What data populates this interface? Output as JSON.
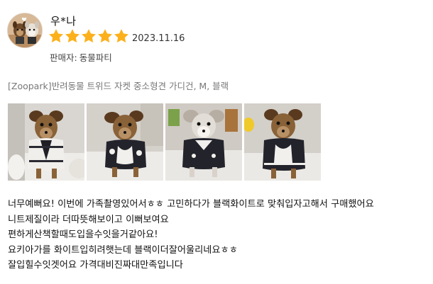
{
  "reviewer": {
    "name": "우*나",
    "avatar_icon": "dog-profile-photo"
  },
  "rating": {
    "value": 5,
    "max": 5,
    "color": "#fcb01b"
  },
  "date": "2023.11.16",
  "seller": {
    "label": "판매자:",
    "name": "동물파티"
  },
  "product": {
    "name": "[Zoopark]반려동물 트위드 자켓 중소형견 가디건, M, 블랙"
  },
  "photos": [
    {
      "name": "review-photo-1",
      "subject": "dog in tweed cardigan, front view"
    },
    {
      "name": "review-photo-2",
      "subject": "dog in tweed cardigan, side view"
    },
    {
      "name": "review-photo-3",
      "subject": "dog in tweed cardigan, sitting"
    },
    {
      "name": "review-photo-4",
      "subject": "dog in tweed cardigan, close up"
    }
  ],
  "review_text": [
    "너무예뻐요! 이번에 가족촬영있어서ㅎㅎ 고민하다가 블랙화이트로 맞춰입자고해서 구매했어요",
    "니트제질이라 더따뜻해보이고 이뻐보여요",
    "편하게산책할때도입을수잇을거같아요!",
    "요키아가를 화이트입히려햇는데 블랙이더잘어울리네요ㅎㅎ",
    "잘입힐수잇겟어요 가격대비진짜대만족입니다"
  ]
}
